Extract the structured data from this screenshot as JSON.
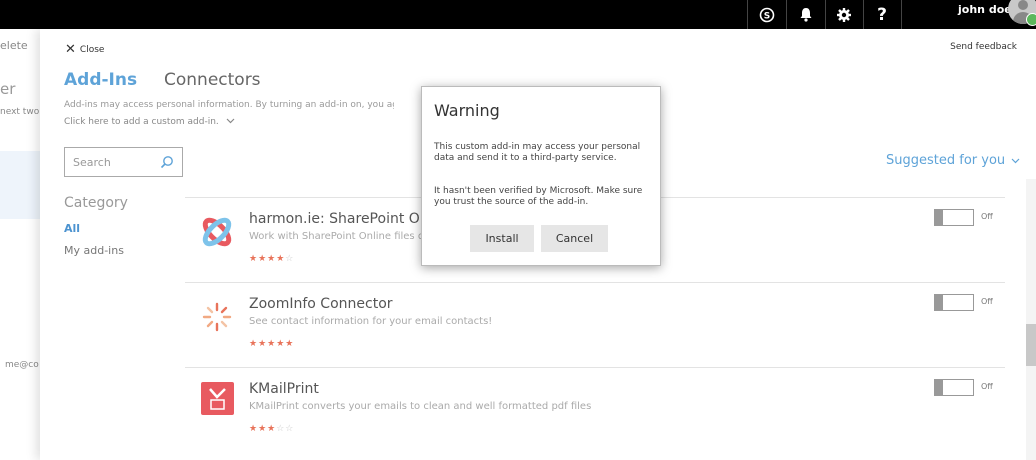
{
  "topbar": {
    "icons": [
      "skype-icon",
      "bell-icon",
      "gear-icon",
      "help-icon"
    ],
    "user_name": "john doe"
  },
  "background": {
    "partial_texts": [
      "elete",
      "er",
      "next two d",
      "me@co"
    ]
  },
  "panel": {
    "close_label": "Close",
    "feedback_label": "Send feedback",
    "tabs": [
      {
        "label": "Add-Ins",
        "active": true
      },
      {
        "label": "Connectors",
        "active": false
      }
    ],
    "disclaimer": "Add-ins may access personal information. By turning an add-in on, you agree to its Lice",
    "custom_link": "Click here to add a custom add-in.",
    "search_placeholder": "Search",
    "category_heading": "Category",
    "categories": [
      "All",
      "My add-ins"
    ],
    "sort_label": "Suggested for you",
    "addins": [
      {
        "title": "harmon.ie: SharePoint Online",
        "description": "Work with SharePoint Online files di",
        "rating": 4,
        "toggle": "Off"
      },
      {
        "title": "ZoomInfo Connector",
        "description": "See contact information for your email contacts!",
        "rating": 5,
        "toggle": "Off"
      },
      {
        "title": "KMailPrint",
        "description": "KMailPrint converts your emails to clean and well formatted pdf files",
        "rating": 3,
        "toggle": "Off"
      }
    ]
  },
  "dialog": {
    "title": "Warning",
    "paragraph1": "This custom add-in may access your personal data and send it to a third-party service.",
    "paragraph2": "It hasn't been verified by Microsoft. Make sure you trust the source of the add-in.",
    "install_label": "Install",
    "cancel_label": "Cancel"
  },
  "colors": {
    "accent": "#5ea3d8",
    "star": "#e8735a",
    "topbar": "#000000",
    "presence": "#5cb85c"
  }
}
